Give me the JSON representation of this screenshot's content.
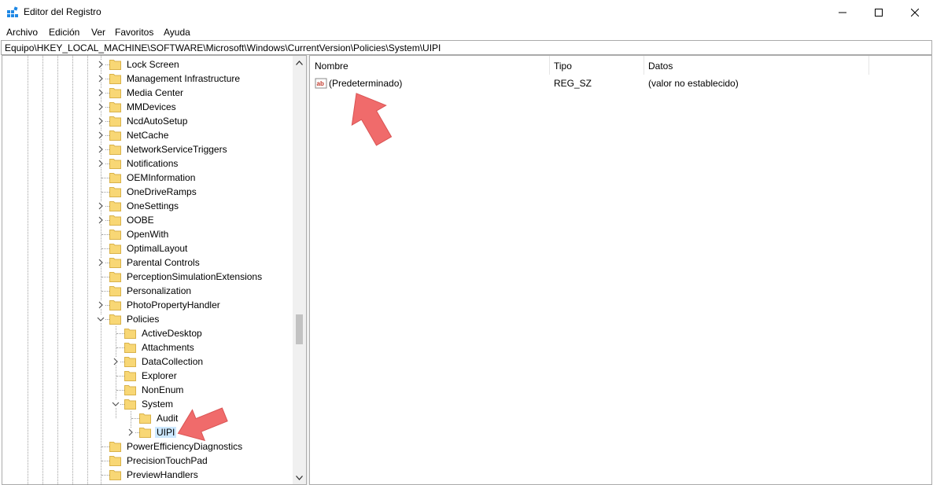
{
  "window": {
    "title": "Editor del Registro",
    "icon": "registry-icon",
    "controls": [
      "minimize-icon",
      "maximize-icon",
      "close-icon"
    ]
  },
  "menu": [
    "Archivo",
    "Edición",
    "Ver",
    "Favoritos",
    "Ayuda"
  ],
  "address": "Equipo\\HKEY_LOCAL_MACHINE\\SOFTWARE\\Microsoft\\Windows\\CurrentVersion\\Policies\\System\\UIPI",
  "tree": {
    "items": [
      {
        "label": "Lock Screen",
        "level": 0,
        "expander": "collapsed"
      },
      {
        "label": "Management Infrastructure",
        "level": 0,
        "expander": "collapsed"
      },
      {
        "label": "Media Center",
        "level": 0,
        "expander": "collapsed"
      },
      {
        "label": "MMDevices",
        "level": 0,
        "expander": "collapsed"
      },
      {
        "label": "NcdAutoSetup",
        "level": 0,
        "expander": "collapsed"
      },
      {
        "label": "NetCache",
        "level": 0,
        "expander": "collapsed"
      },
      {
        "label": "NetworkServiceTriggers",
        "level": 0,
        "expander": "collapsed"
      },
      {
        "label": "Notifications",
        "level": 0,
        "expander": "collapsed"
      },
      {
        "label": "OEMInformation",
        "level": 0,
        "expander": "none"
      },
      {
        "label": "OneDriveRamps",
        "level": 0,
        "expander": "none"
      },
      {
        "label": "OneSettings",
        "level": 0,
        "expander": "collapsed"
      },
      {
        "label": "OOBE",
        "level": 0,
        "expander": "collapsed"
      },
      {
        "label": "OpenWith",
        "level": 0,
        "expander": "none"
      },
      {
        "label": "OptimalLayout",
        "level": 0,
        "expander": "none"
      },
      {
        "label": "Parental Controls",
        "level": 0,
        "expander": "collapsed"
      },
      {
        "label": "PerceptionSimulationExtensions",
        "level": 0,
        "expander": "none"
      },
      {
        "label": "Personalization",
        "level": 0,
        "expander": "none"
      },
      {
        "label": "PhotoPropertyHandler",
        "level": 0,
        "expander": "collapsed"
      },
      {
        "label": "Policies",
        "level": 0,
        "expander": "expanded"
      },
      {
        "label": "ActiveDesktop",
        "level": 1,
        "expander": "none"
      },
      {
        "label": "Attachments",
        "level": 1,
        "expander": "none"
      },
      {
        "label": "DataCollection",
        "level": 1,
        "expander": "collapsed"
      },
      {
        "label": "Explorer",
        "level": 1,
        "expander": "none"
      },
      {
        "label": "NonEnum",
        "level": 1,
        "expander": "none"
      },
      {
        "label": "System",
        "level": 1,
        "expander": "expanded"
      },
      {
        "label": "Audit",
        "level": 2,
        "expander": "none"
      },
      {
        "label": "UIPI",
        "level": 2,
        "expander": "collapsed",
        "selected": true
      },
      {
        "label": "PowerEfficiencyDiagnostics",
        "level": 0,
        "expander": "none"
      },
      {
        "label": "PrecisionTouchPad",
        "level": 0,
        "expander": "none"
      },
      {
        "label": "PreviewHandlers",
        "level": 0,
        "expander": "none"
      }
    ],
    "scroll_thumb_position": 0.66
  },
  "list": {
    "columns": [
      "Nombre",
      "Tipo",
      "Datos"
    ],
    "rows": [
      {
        "name": "(Predeterminado)",
        "type": "REG_SZ",
        "data": "(valor no establecido)",
        "icon": "string-value-icon"
      }
    ]
  },
  "colors": {
    "selection": "#cce8ff",
    "folder": "#f8d775",
    "annotation_arrow": "#f06b6b"
  }
}
